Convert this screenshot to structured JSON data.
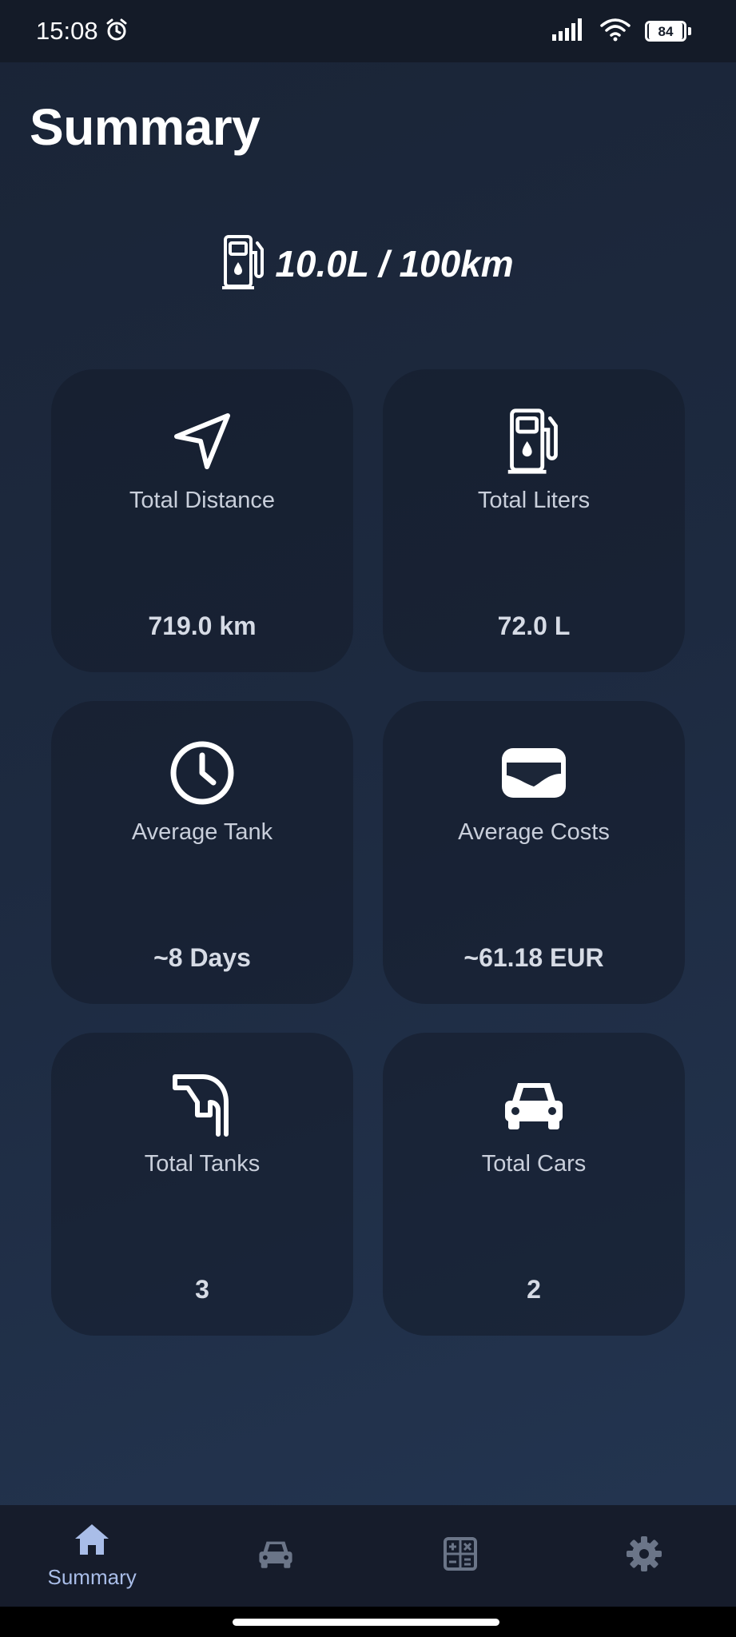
{
  "status_bar": {
    "time": "15:08",
    "battery": "84",
    "icons": [
      "alarm-icon",
      "signal-icon",
      "wifi-icon",
      "battery-icon"
    ]
  },
  "page": {
    "title": "Summary"
  },
  "efficiency": {
    "icon": "fuel-pump-icon",
    "value": "10.0L / 100km"
  },
  "cards": [
    {
      "icon": "navigation-arrow-icon",
      "label": "Total Distance",
      "value": "719.0 km"
    },
    {
      "icon": "fuel-pump-icon",
      "label": "Total Liters",
      "value": "72.0 L"
    },
    {
      "icon": "clock-icon",
      "label": "Average Tank",
      "value": "~8 Days"
    },
    {
      "icon": "wallet-icon",
      "label": "Average Costs",
      "value": "~61.18 EUR"
    },
    {
      "icon": "fuel-nozzle-icon",
      "label": "Total Tanks",
      "value": "3"
    },
    {
      "icon": "car-icon",
      "label": "Total Cars",
      "value": "2"
    }
  ],
  "bottom_nav": {
    "items": [
      {
        "icon": "home-icon",
        "label": "Summary",
        "active": true
      },
      {
        "icon": "car-icon",
        "label": "",
        "active": false
      },
      {
        "icon": "calculator-icon",
        "label": "",
        "active": false
      },
      {
        "icon": "gear-icon",
        "label": "",
        "active": false
      }
    ],
    "active_color": "#a9bde8",
    "inactive_color": "#6b7588"
  }
}
